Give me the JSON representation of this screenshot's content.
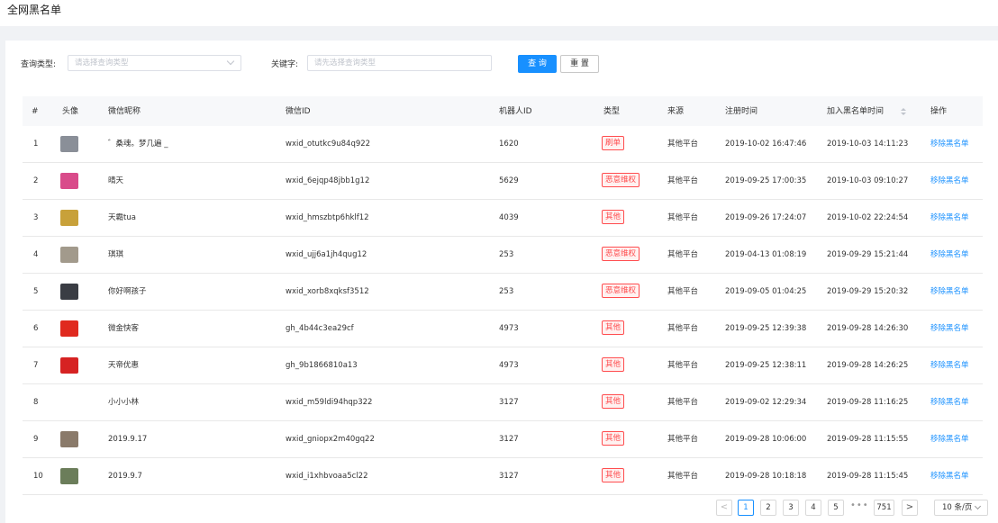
{
  "page": {
    "title": "全网黑名单"
  },
  "filter": {
    "type_label": "查询类型:",
    "type_placeholder": "请选择查询类型",
    "keyword_label": "关键字:",
    "keyword_placeholder": "请先选择查询类型",
    "query_label": "查 询",
    "reset_label": "重 置"
  },
  "table": {
    "headers": {
      "index": "#",
      "avatar": "头像",
      "nickname": "微信昵称",
      "wxid": "微信ID",
      "robot_id": "机器人ID",
      "type": "类型",
      "source": "来源",
      "register_time": "注册时间",
      "blacklist_time": "加入黑名单时间",
      "action": "操作"
    },
    "rows": [
      {
        "index": "1",
        "nickname": "゛桑魂。梦几遍 _",
        "wxid": "wxid_otutkc9u84q922",
        "robot_id": "1620",
        "type": "刷单",
        "source": "其他平台",
        "register_time": "2019-10-02 16:47:46",
        "blacklist_time": "2019-10-03 14:11:23",
        "action": "移除黑名单",
        "avatar_color": "#8a8f98",
        "has_avatar": true
      },
      {
        "index": "2",
        "nickname": "晴天",
        "wxid": "wxid_6ejqp48jbb1g12",
        "robot_id": "5629",
        "type": "恶意维权",
        "source": "其他平台",
        "register_time": "2019-09-25 17:00:35",
        "blacklist_time": "2019-10-03 09:10:27",
        "action": "移除黑名单",
        "avatar_color": "#d94b8a",
        "has_avatar": true
      },
      {
        "index": "3",
        "nickname": "天霸tua",
        "wxid": "wxid_hmszbtp6hklf12",
        "robot_id": "4039",
        "type": "其他",
        "source": "其他平台",
        "register_time": "2019-09-26 17:24:07",
        "blacklist_time": "2019-10-02 22:24:54",
        "action": "移除黑名单",
        "avatar_color": "#c8a13a",
        "has_avatar": true
      },
      {
        "index": "4",
        "nickname": "琪琪",
        "wxid": "wxid_ujj6a1jh4qug12",
        "robot_id": "253",
        "type": "恶意维权",
        "source": "其他平台",
        "register_time": "2019-04-13 01:08:19",
        "blacklist_time": "2019-09-29 15:21:44",
        "action": "移除黑名单",
        "avatar_color": "#a29a8c",
        "has_avatar": true
      },
      {
        "index": "5",
        "nickname": "你好啊孩子",
        "wxid": "wxid_xorb8xqksf3512",
        "robot_id": "253",
        "type": "恶意维权",
        "source": "其他平台",
        "register_time": "2019-09-05 01:04:25",
        "blacklist_time": "2019-09-29 15:20:32",
        "action": "移除黑名单",
        "avatar_color": "#3a3d44",
        "has_avatar": true
      },
      {
        "index": "6",
        "nickname": "微金快客",
        "wxid": "gh_4b44c3ea29cf",
        "robot_id": "4973",
        "type": "其他",
        "source": "其他平台",
        "register_time": "2019-09-25 12:39:38",
        "blacklist_time": "2019-09-28 14:26:30",
        "action": "移除黑名单",
        "avatar_color": "#e02a1f",
        "has_avatar": true
      },
      {
        "index": "7",
        "nickname": "天帝优惠",
        "wxid": "gh_9b1866810a13",
        "robot_id": "4973",
        "type": "其他",
        "source": "其他平台",
        "register_time": "2019-09-25 12:38:11",
        "blacklist_time": "2019-09-28 14:26:25",
        "action": "移除黑名单",
        "avatar_color": "#d62222",
        "has_avatar": true
      },
      {
        "index": "8",
        "nickname": "小小小林",
        "wxid": "wxid_m59ldi94hqp322",
        "robot_id": "3127",
        "type": "其他",
        "source": "其他平台",
        "register_time": "2019-09-02 12:29:34",
        "blacklist_time": "2019-09-28 11:16:25",
        "action": "移除黑名单",
        "avatar_color": "#ffffff",
        "has_avatar": false
      },
      {
        "index": "9",
        "nickname": "2019.9.17",
        "wxid": "wxid_gniopx2m40gq22",
        "robot_id": "3127",
        "type": "其他",
        "source": "其他平台",
        "register_time": "2019-09-28 10:06:00",
        "blacklist_time": "2019-09-28 11:15:55",
        "action": "移除黑名单",
        "avatar_color": "#8a7a6a",
        "has_avatar": true
      },
      {
        "index": "10",
        "nickname": "2019.9.7",
        "wxid": "wxid_i1xhbvoaa5cl22",
        "robot_id": "3127",
        "type": "其他",
        "source": "其他平台",
        "register_time": "2019-09-28 10:18:18",
        "blacklist_time": "2019-09-28 11:15:45",
        "action": "移除黑名单",
        "avatar_color": "#6b7d5a",
        "has_avatar": true
      }
    ]
  },
  "pagination": {
    "prev": "<",
    "pages": [
      "1",
      "2",
      "3",
      "4",
      "5"
    ],
    "current": "1",
    "ellipsis": "•••",
    "last": "751",
    "next": ">",
    "page_size": "10 条/页"
  }
}
